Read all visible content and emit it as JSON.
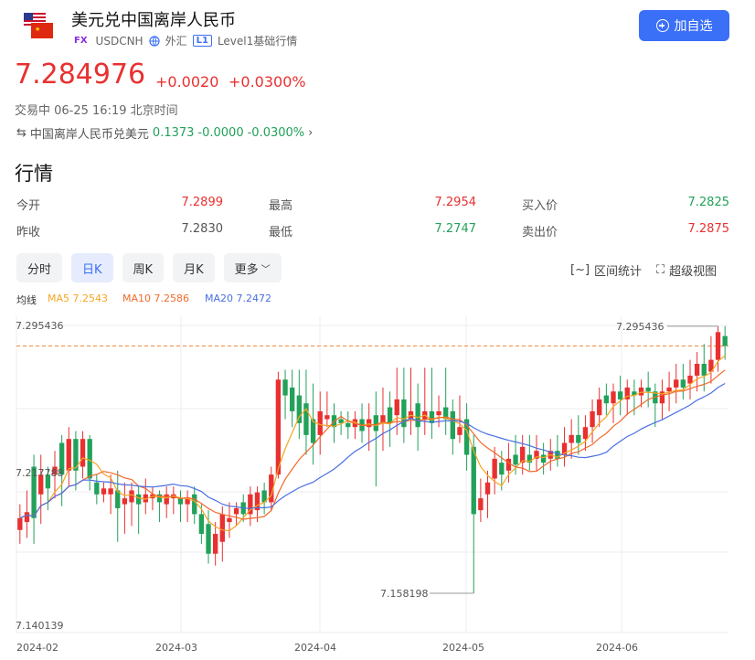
{
  "header": {
    "title": "美元兑中国离岸人民币",
    "fx_tag": "FX",
    "code": "USDCNH",
    "market": "外汇",
    "level_tag": "L1",
    "level": "Level1基础行情",
    "add_button": "加自选"
  },
  "quote": {
    "price": "7.284976",
    "change": "+0.0020",
    "change_pct": "+0.0300%",
    "status": "交易中 06-25 16:19 北京时间"
  },
  "cross": {
    "name": "中国离岸人民币兑美元",
    "price": "0.1373",
    "change": "-0.0000",
    "change_pct": "-0.0300%"
  },
  "stats": {
    "heading": "行情",
    "rows": [
      [
        {
          "label": "今开",
          "value": "7.2899",
          "color": "red"
        },
        {
          "label": "最高",
          "value": "7.2954",
          "color": "red"
        },
        {
          "label": "买入价",
          "value": "7.2825",
          "color": "green"
        }
      ],
      [
        {
          "label": "昨收",
          "value": "7.2830",
          "color": "gray"
        },
        {
          "label": "最低",
          "value": "7.2747",
          "color": "green"
        },
        {
          "label": "卖出价",
          "value": "7.2875",
          "color": "red"
        }
      ]
    ]
  },
  "tabs": [
    "分时",
    "日K",
    "周K",
    "月K",
    "更多"
  ],
  "active_tab": "日K",
  "tools": {
    "range_stats": "区间统计",
    "super_view": "超级视图"
  },
  "ma_legend": {
    "label": "均线",
    "ma5": "MA5 7.2543",
    "ma10": "MA10 7.2586",
    "ma20": "MA20 7.2472"
  },
  "colors": {
    "up": "#e93030",
    "down": "#22a15a",
    "accent": "#3a6ff7",
    "ma5": "#f5a623",
    "ma10": "#f06a2a",
    "ma20": "#4a6fe3",
    "last_price_line": "#f08a3a"
  },
  "chart_data": {
    "type": "candlestick",
    "y_ticks": [
      "7.295436",
      "7.217788",
      "7.140139"
    ],
    "x_ticks": [
      "2024-02",
      "2024-03",
      "2024-04",
      "2024-05",
      "2024-06"
    ],
    "high_label": "7.295436",
    "low_label": "7.158198",
    "ylim": [
      7.140139,
      7.3
    ],
    "last_price": 7.285,
    "candles": [
      [
        7.192,
        7.198,
        7.205,
        7.185
      ],
      [
        7.196,
        7.201,
        7.212,
        7.188
      ],
      [
        7.224,
        7.198,
        7.23,
        7.185
      ],
      [
        7.21,
        7.22,
        7.23,
        7.195
      ],
      [
        7.22,
        7.213,
        7.224,
        7.202
      ],
      [
        7.22,
        7.224,
        7.232,
        7.208
      ],
      [
        7.236,
        7.22,
        7.24,
        7.204
      ],
      [
        7.222,
        7.238,
        7.244,
        7.214
      ],
      [
        7.238,
        7.222,
        7.242,
        7.212
      ],
      [
        7.224,
        7.238,
        7.242,
        7.218
      ],
      [
        7.238,
        7.218,
        7.24,
        7.212
      ],
      [
        7.216,
        7.21,
        7.22,
        7.205
      ],
      [
        7.21,
        7.213,
        7.216,
        7.206
      ],
      [
        7.21,
        7.213,
        7.22,
        7.2
      ],
      [
        7.212,
        7.203,
        7.222,
        7.186
      ],
      [
        7.205,
        7.208,
        7.216,
        7.19
      ],
      [
        7.206,
        7.212,
        7.216,
        7.194
      ],
      [
        7.21,
        7.205,
        7.214,
        7.19
      ],
      [
        7.206,
        7.21,
        7.218,
        7.2
      ],
      [
        7.208,
        7.21,
        7.214,
        7.202
      ],
      [
        7.21,
        7.206,
        7.212,
        7.196
      ],
      [
        7.205,
        7.21,
        7.214,
        7.198
      ],
      [
        7.208,
        7.21,
        7.214,
        7.2
      ],
      [
        7.208,
        7.205,
        7.212,
        7.196
      ],
      [
        7.205,
        7.208,
        7.212,
        7.196
      ],
      [
        7.21,
        7.2,
        7.214,
        7.195
      ],
      [
        7.2,
        7.19,
        7.205,
        7.185
      ],
      [
        7.195,
        7.18,
        7.202,
        7.175
      ],
      [
        7.18,
        7.19,
        7.196,
        7.174
      ],
      [
        7.186,
        7.2,
        7.204,
        7.176
      ],
      [
        7.196,
        7.198,
        7.206,
        7.188
      ],
      [
        7.2,
        7.203,
        7.206,
        7.194
      ],
      [
        7.206,
        7.2,
        7.21,
        7.196
      ],
      [
        7.2,
        7.21,
        7.214,
        7.194
      ],
      [
        7.202,
        7.211,
        7.214,
        7.196
      ],
      [
        7.212,
        7.206,
        7.216,
        7.2
      ],
      [
        7.206,
        7.22,
        7.224,
        7.202
      ],
      [
        7.22,
        7.268,
        7.272,
        7.218
      ],
      [
        7.268,
        7.26,
        7.273,
        7.248
      ],
      [
        7.264,
        7.252,
        7.273,
        7.244
      ],
      [
        7.26,
        7.246,
        7.273,
        7.238
      ],
      [
        7.256,
        7.24,
        7.273,
        7.23
      ],
      [
        7.248,
        7.236,
        7.266,
        7.225
      ],
      [
        7.24,
        7.252,
        7.262,
        7.23
      ],
      [
        7.248,
        7.25,
        7.262,
        7.244
      ],
      [
        7.25,
        7.244,
        7.256,
        7.236
      ],
      [
        7.248,
        7.246,
        7.252,
        7.24
      ],
      [
        7.246,
        7.244,
        7.252,
        7.238
      ],
      [
        7.244,
        7.248,
        7.252,
        7.238
      ],
      [
        7.248,
        7.242,
        7.256,
        7.236
      ],
      [
        7.244,
        7.248,
        7.256,
        7.232
      ],
      [
        7.25,
        7.242,
        7.262,
        7.214
      ],
      [
        7.246,
        7.25,
        7.264,
        7.232
      ],
      [
        7.254,
        7.246,
        7.262,
        7.234
      ],
      [
        7.25,
        7.258,
        7.274,
        7.24
      ],
      [
        7.258,
        7.244,
        7.274,
        7.236
      ],
      [
        7.248,
        7.252,
        7.274,
        7.24
      ],
      [
        7.256,
        7.244,
        7.266,
        7.232
      ],
      [
        7.248,
        7.252,
        7.274,
        7.24
      ],
      [
        7.252,
        7.246,
        7.274,
        7.238
      ],
      [
        7.25,
        7.252,
        7.26,
        7.244
      ],
      [
        7.254,
        7.248,
        7.274,
        7.24
      ],
      [
        7.252,
        7.238,
        7.258,
        7.23
      ],
      [
        7.24,
        7.244,
        7.26,
        7.236
      ],
      [
        7.248,
        7.23,
        7.256,
        7.222
      ],
      [
        7.234,
        7.2,
        7.24,
        7.16
      ],
      [
        7.202,
        7.208,
        7.218,
        7.196
      ],
      [
        7.21,
        7.216,
        7.222,
        7.198
      ],
      [
        7.218,
        7.228,
        7.234,
        7.21
      ],
      [
        7.226,
        7.22,
        7.232,
        7.212
      ],
      [
        7.222,
        7.228,
        7.236,
        7.216
      ],
      [
        7.23,
        7.225,
        7.24,
        7.22
      ],
      [
        7.226,
        7.234,
        7.24,
        7.22
      ],
      [
        7.23,
        7.226,
        7.24,
        7.222
      ],
      [
        7.228,
        7.232,
        7.24,
        7.222
      ],
      [
        7.23,
        7.226,
        7.236,
        7.22
      ],
      [
        7.228,
        7.232,
        7.238,
        7.222
      ],
      [
        7.232,
        7.228,
        7.24,
        7.224
      ],
      [
        7.23,
        7.236,
        7.244,
        7.224
      ],
      [
        7.236,
        7.24,
        7.248,
        7.228
      ],
      [
        7.24,
        7.236,
        7.25,
        7.23
      ],
      [
        7.238,
        7.244,
        7.25,
        7.232
      ],
      [
        7.244,
        7.252,
        7.258,
        7.236
      ],
      [
        7.25,
        7.258,
        7.264,
        7.244
      ],
      [
        7.26,
        7.256,
        7.266,
        7.25
      ],
      [
        7.256,
        7.262,
        7.266,
        7.246
      ],
      [
        7.262,
        7.258,
        7.27,
        7.25
      ],
      [
        7.258,
        7.264,
        7.268,
        7.25
      ],
      [
        7.262,
        7.26,
        7.268,
        7.25
      ],
      [
        7.26,
        7.264,
        7.268,
        7.254
      ],
      [
        7.264,
        7.262,
        7.272,
        7.254
      ],
      [
        7.262,
        7.256,
        7.266,
        7.244
      ],
      [
        7.256,
        7.262,
        7.268,
        7.248
      ],
      [
        7.262,
        7.264,
        7.272,
        7.252
      ],
      [
        7.264,
        7.268,
        7.276,
        7.256
      ],
      [
        7.268,
        7.264,
        7.276,
        7.258
      ],
      [
        7.266,
        7.27,
        7.278,
        7.258
      ],
      [
        7.27,
        7.276,
        7.282,
        7.262
      ],
      [
        7.276,
        7.27,
        7.286,
        7.262
      ],
      [
        7.272,
        7.278,
        7.29,
        7.266
      ],
      [
        7.278,
        7.292,
        7.295,
        7.272
      ],
      [
        7.29,
        7.285,
        7.295,
        7.278
      ]
    ]
  }
}
